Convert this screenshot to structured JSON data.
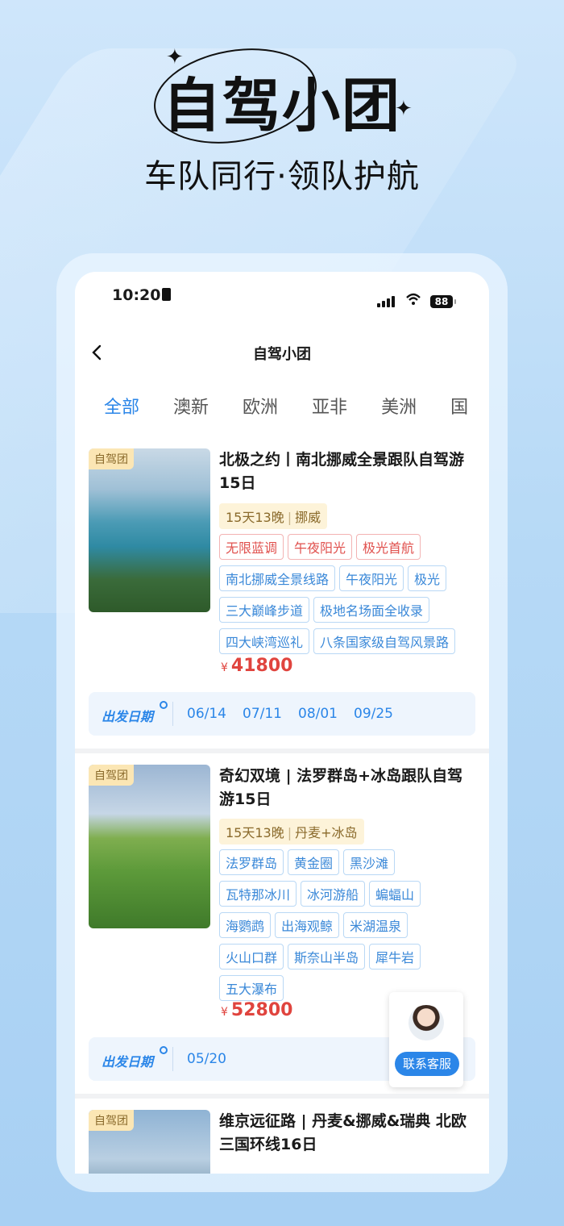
{
  "hero": {
    "title": "自驾小团",
    "subtitle": "车队同行·领队护航"
  },
  "status_bar": {
    "time": "10:20",
    "battery": "88"
  },
  "nav": {
    "title": "自驾小团"
  },
  "tabs": [
    {
      "label": "全部",
      "active": true
    },
    {
      "label": "澳新"
    },
    {
      "label": "欧洲"
    },
    {
      "label": "亚非"
    },
    {
      "label": "美洲"
    },
    {
      "label": "国"
    }
  ],
  "products": [
    {
      "badge": "自驾团",
      "title": "北极之约丨南北挪威全景跟队自驾游15日",
      "days": "15天13晚",
      "country": "挪威",
      "tags_red": [
        "无限蓝调",
        "午夜阳光",
        "极光首航"
      ],
      "tags": [
        "南北挪威全景线路",
        "午夜阳光",
        "极光",
        "三大巅峰步道",
        "极地名场面全收录",
        "四大峡湾巡礼",
        "八条国家级自驾风景路"
      ],
      "price_symbol": "¥",
      "price": "41800",
      "dates_label": "出发日期",
      "dates": [
        "06/14",
        "07/11",
        "08/01",
        "09/25"
      ]
    },
    {
      "badge": "自驾团",
      "title": "奇幻双境 | 法罗群岛+冰岛跟队自驾游15日",
      "days": "15天13晚",
      "country": "丹麦+冰岛",
      "tags_red": [],
      "tags": [
        "法罗群岛",
        "黄金圈",
        "黑沙滩",
        "瓦特那冰川",
        "冰河游船",
        "蝙蝠山",
        "海鹦鹉",
        "出海观鲸",
        "米湖温泉",
        "火山口群",
        "斯奈山半岛",
        "犀牛岩",
        "五大瀑布"
      ],
      "price_symbol": "¥",
      "price": "52800",
      "dates_label": "出发日期",
      "dates": [
        "05/20"
      ]
    },
    {
      "badge": "自驾团",
      "title": "维京远征路 | 丹麦&挪威&瑞典 北欧三国环线16日"
    }
  ],
  "customer_service": {
    "label": "联系客服"
  },
  "colors": {
    "accent": "#2b86e8",
    "price": "#e0443e",
    "badge_bg": "#fbe6b4"
  }
}
